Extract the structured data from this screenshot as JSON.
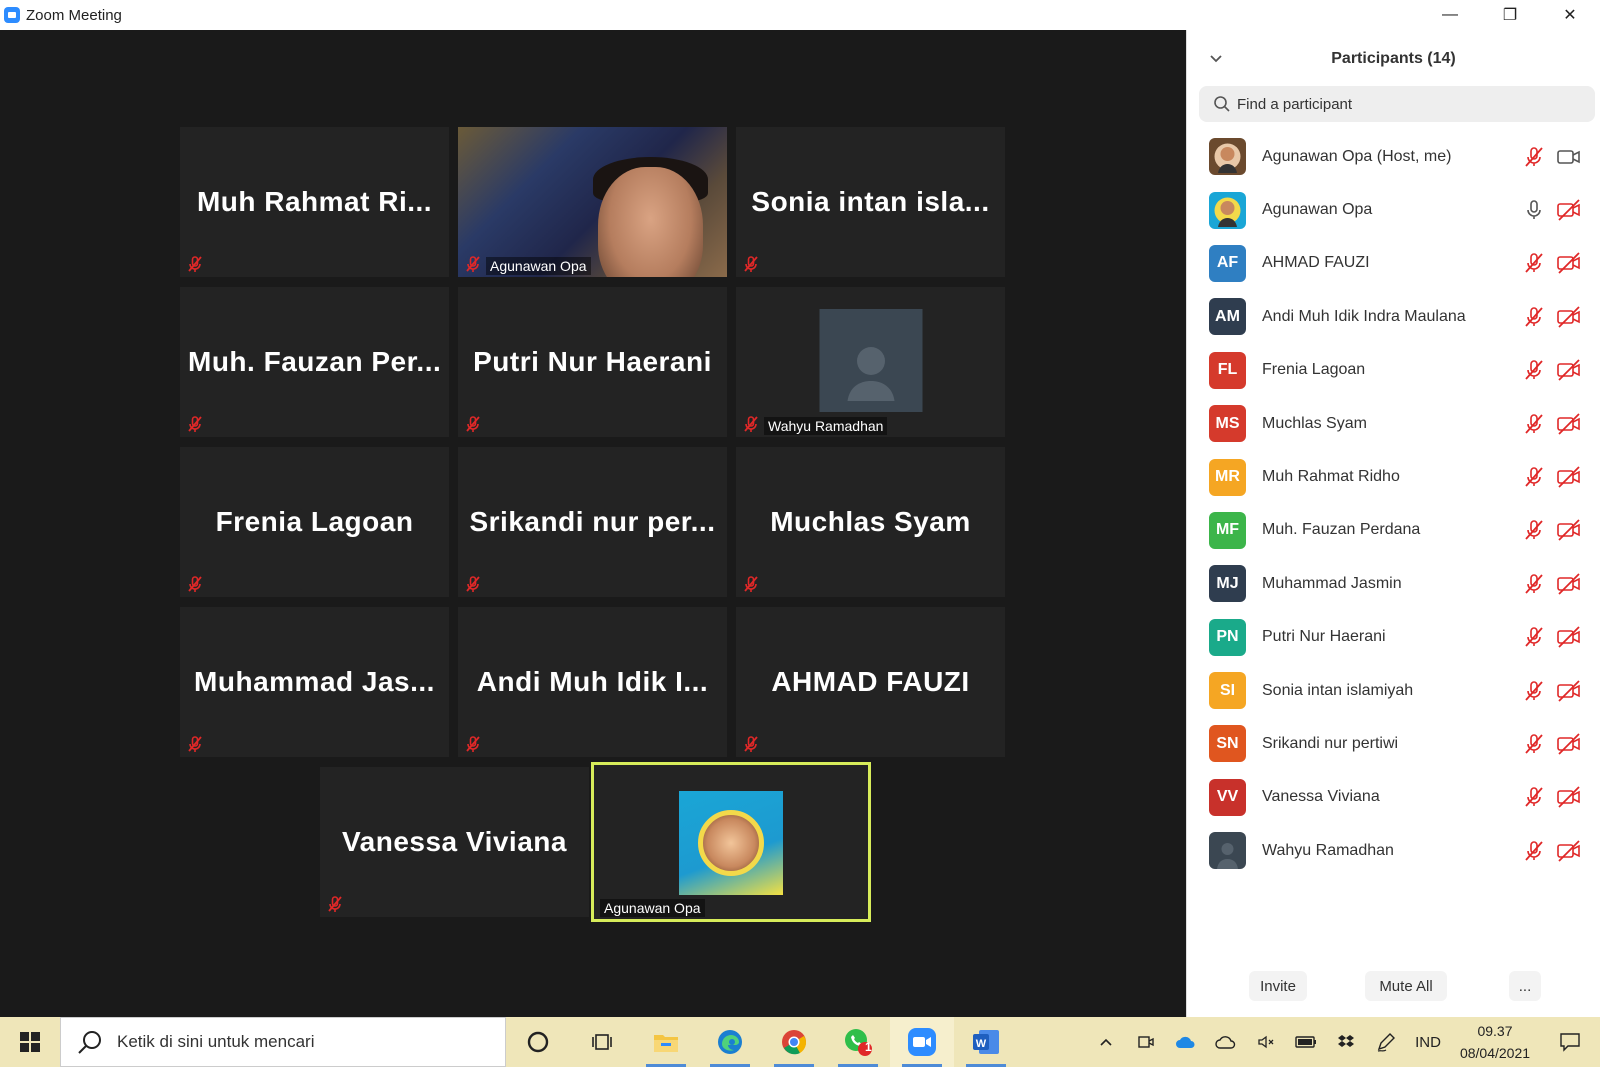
{
  "window": {
    "title": "Zoom Meeting",
    "minimize_glyph": "—",
    "restore_glyph": "❐",
    "close_glyph": "✕"
  },
  "tiles": [
    {
      "name": "Muh Rahmat Ri...",
      "muted": true
    },
    {
      "name": "Agunawan Opa",
      "video": true,
      "muted": true
    },
    {
      "name": "Sonia intan isla...",
      "muted": true
    },
    {
      "name": "Muh. Fauzan Per...",
      "muted": true
    },
    {
      "name": "Putri Nur Haerani",
      "muted": true
    },
    {
      "name": "Wahyu Ramadhan",
      "photo_placeholder": true,
      "muted": true
    },
    {
      "name": "Frenia Lagoan",
      "muted": true
    },
    {
      "name": "Srikandi nur per...",
      "muted": true
    },
    {
      "name": "Muchlas Syam",
      "muted": true
    },
    {
      "name": "Muhammad Jas...",
      "muted": true
    },
    {
      "name": "Andi Muh Idik I...",
      "muted": true
    },
    {
      "name": "AHMAD FAUZI",
      "muted": true
    },
    {
      "name": "Vanessa Viviana",
      "muted": true
    },
    {
      "name": "Agunawan Opa",
      "active_speaker": true,
      "muted": false
    }
  ],
  "participants_panel": {
    "title": "Participants (14)",
    "search_placeholder": "Find a participant",
    "participants": [
      {
        "name": "Agunawan Opa (Host, me)",
        "initials": "",
        "color": "#6b4a2e",
        "mic": "muted",
        "video": "on"
      },
      {
        "name": "Agunawan Opa",
        "initials": "",
        "color": "#1aa6d6",
        "mic": "on",
        "video": "off"
      },
      {
        "name": "AHMAD FAUZI",
        "initials": "AF",
        "color": "#2f7fc2",
        "mic": "muted",
        "video": "off"
      },
      {
        "name": "Andi Muh Idik Indra Maulana",
        "initials": "AM",
        "color": "#2f3d4f",
        "mic": "muted",
        "video": "off"
      },
      {
        "name": "Frenia Lagoan",
        "initials": "FL",
        "color": "#d53a2c",
        "mic": "muted",
        "video": "off"
      },
      {
        "name": "Muchlas Syam",
        "initials": "MS",
        "color": "#d53a2c",
        "mic": "muted",
        "video": "off"
      },
      {
        "name": "Muh Rahmat Ridho",
        "initials": "MR",
        "color": "#f5a623",
        "mic": "muted",
        "video": "off"
      },
      {
        "name": "Muh. Fauzan Perdana",
        "initials": "MF",
        "color": "#3cb54a",
        "mic": "muted",
        "video": "off"
      },
      {
        "name": "Muhammad Jasmin",
        "initials": "MJ",
        "color": "#2f3d4f",
        "mic": "muted",
        "video": "off"
      },
      {
        "name": "Putri Nur Haerani",
        "initials": "PN",
        "color": "#1aaa8a",
        "mic": "muted",
        "video": "off"
      },
      {
        "name": "Sonia intan islamiyah",
        "initials": "SI",
        "color": "#f5a623",
        "mic": "muted",
        "video": "off"
      },
      {
        "name": "Srikandi nur pertiwi",
        "initials": "SN",
        "color": "#e0561f",
        "mic": "muted",
        "video": "off"
      },
      {
        "name": "Vanessa Viviana",
        "initials": "VV",
        "color": "#c8312b",
        "mic": "muted",
        "video": "off"
      },
      {
        "name": "Wahyu Ramadhan",
        "initials": "",
        "color": "#3b4752",
        "mic": "muted",
        "video": "off"
      }
    ],
    "footer": {
      "invite": "Invite",
      "mute_all": "Mute All",
      "more": "..."
    }
  },
  "taskbar": {
    "search_placeholder": "Ketik di sini untuk mencari",
    "apps": [
      "cortana-icon",
      "task-view-icon",
      "file-explorer-icon",
      "edge-icon",
      "chrome-icon",
      "whatsapp-icon",
      "zoom-icon",
      "word-icon"
    ],
    "whatsapp_badge": "1",
    "language": "IND",
    "time": "09.37",
    "date": "08/04/2021"
  }
}
